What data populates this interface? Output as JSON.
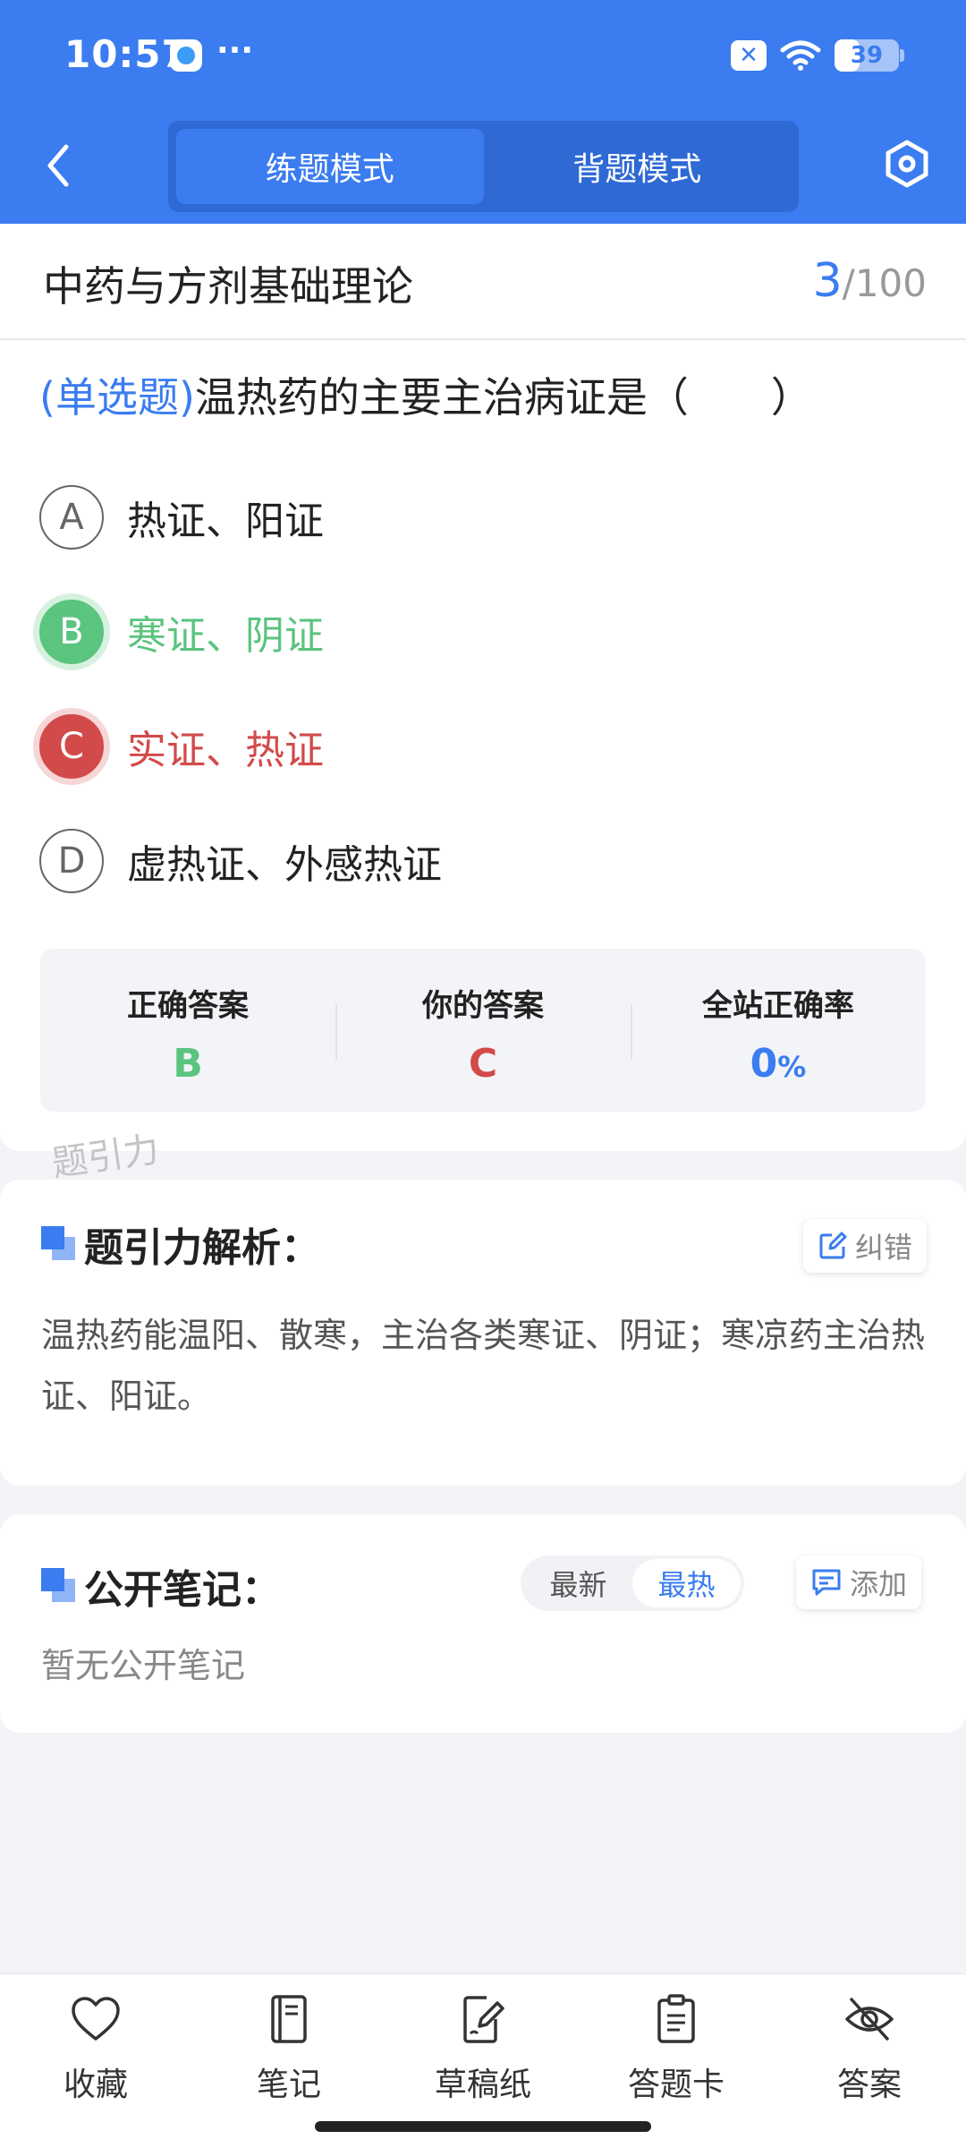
{
  "status_bar": {
    "time": "10:57",
    "dots": "···",
    "battery": "39",
    "battery_level": 0.39
  },
  "header": {
    "tabs": [
      {
        "label": "练题模式",
        "active": true
      },
      {
        "label": "背题模式",
        "active": false
      }
    ],
    "icons": {
      "back": "chevron-left-icon",
      "settings": "hexagon-settings-icon"
    }
  },
  "question": {
    "subject": "中药与方剂基础理论",
    "current": "3",
    "total": "/100",
    "type": "(单选题)",
    "text": "温热药的主要主治病证是（　　）",
    "options": [
      {
        "letter": "A",
        "text": "热证、阳证",
        "state": "normal"
      },
      {
        "letter": "B",
        "text": "寒证、阴证",
        "state": "correct"
      },
      {
        "letter": "C",
        "text": "实证、热证",
        "state": "wrong"
      },
      {
        "letter": "D",
        "text": "虚热证、外感热证",
        "state": "normal"
      }
    ]
  },
  "result": {
    "correct_label": "正确答案",
    "correct_value": "B",
    "yours_label": "你的答案",
    "yours_value": "C",
    "rate_label": "全站正确率",
    "rate_value": "0",
    "rate_unit": "%"
  },
  "watermark": "题引力",
  "analysis": {
    "title": "题引力解析：",
    "report_label": "纠错",
    "text": "温热药能温阳、散寒，主治各类寒证、阴证；寒凉药主治热证、阳证。"
  },
  "notes": {
    "title": "公开笔记：",
    "sort_options": [
      {
        "label": "最新",
        "active": false
      },
      {
        "label": "最热",
        "active": true
      }
    ],
    "add_label": "添加",
    "empty_text": "暂无公开笔记"
  },
  "bottom_bar": [
    {
      "label": "收藏",
      "icon": "heart-icon"
    },
    {
      "label": "笔记",
      "icon": "notebook-icon"
    },
    {
      "label": "草稿纸",
      "icon": "draft-paper-icon"
    },
    {
      "label": "答题卡",
      "icon": "answer-sheet-icon"
    },
    {
      "label": "答案",
      "icon": "eye-off-icon"
    }
  ],
  "colors": {
    "primary": "#3b7cf0",
    "correct": "#5bc47f",
    "wrong": "#d24a4a"
  }
}
